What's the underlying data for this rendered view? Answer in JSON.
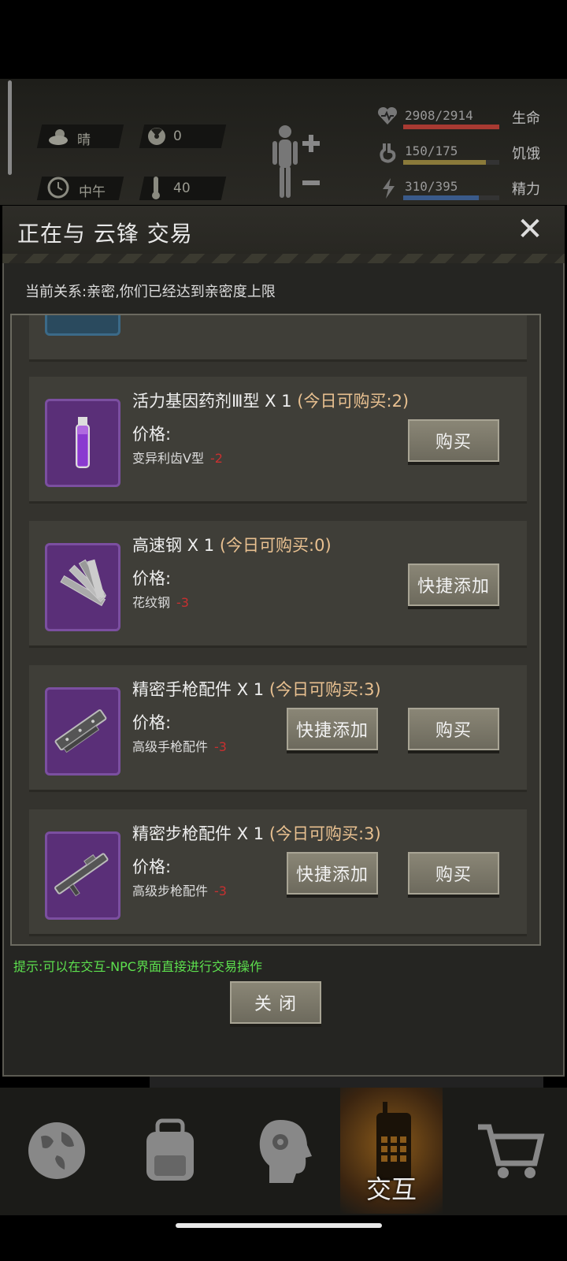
{
  "hud": {
    "weather": "晴",
    "radiation": "0",
    "time": "中午",
    "temperature": "40",
    "stats": [
      {
        "value": "2908/2914",
        "label": "生命",
        "fraction": 0.998,
        "color": "#a83a32"
      },
      {
        "value": "150/175",
        "label": "饥饿",
        "fraction": 0.857,
        "color": "#8a7a3a"
      },
      {
        "value": "310/395",
        "label": "精力",
        "fraction": 0.785,
        "color": "#3a5a8a"
      }
    ]
  },
  "modal": {
    "title": "正在与 云锋 交易",
    "relation": "当前关系:亲密,你们已经达到亲密度上限",
    "hint": "提示:可以在交互-NPC界面直接进行交易操作",
    "close_label": "关 闭"
  },
  "items": [
    {
      "name": "活力基因药剂Ⅲ型",
      "qty": "X 1",
      "limit": "(今日可购买:2)",
      "price_label": "价格:",
      "cost_item": "变异利齿Ⅴ型",
      "cost_val": "-2",
      "quick_label": "",
      "buy_label": "购买",
      "icon": "vial-icon"
    },
    {
      "name": "高速钢",
      "qty": "X 1",
      "limit": "(今日可购买:0)",
      "price_label": "价格:",
      "cost_item": "花纹钢",
      "cost_val": "-3",
      "quick_label": "快捷添加",
      "buy_label": "",
      "icon": "steel-bars-icon"
    },
    {
      "name": "精密手枪配件",
      "qty": "X 1",
      "limit": "(今日可购买:3)",
      "price_label": "价格:",
      "cost_item": "高级手枪配件",
      "cost_val": "-3",
      "quick_label": "快捷添加",
      "buy_label": "购买",
      "icon": "pistol-parts-icon"
    },
    {
      "name": "精密步枪配件",
      "qty": "X 1",
      "limit": "(今日可购买:3)",
      "price_label": "价格:",
      "cost_item": "高级步枪配件",
      "cost_val": "-3",
      "quick_label": "快捷添加",
      "buy_label": "购买",
      "icon": "rifle-parts-icon"
    }
  ],
  "nav": {
    "active_label": "交互",
    "icons": [
      "globe-icon",
      "backpack-icon",
      "head-gear-icon",
      "radio-icon",
      "cart-icon"
    ]
  }
}
